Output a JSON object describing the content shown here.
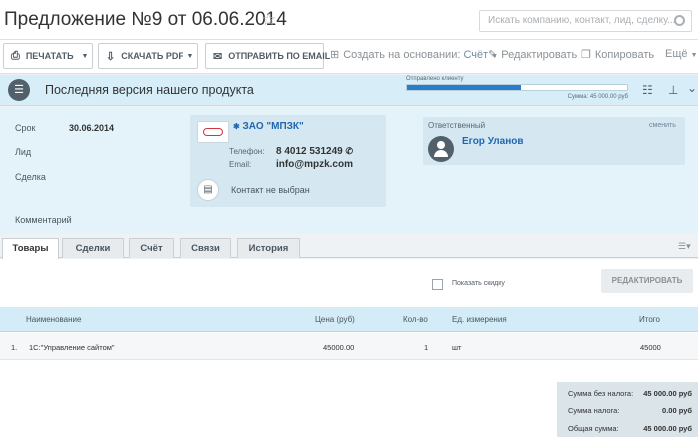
{
  "header": {
    "title": "Предложение №9 от 06.06.2014",
    "search_placeholder": "Искать компанию, контакт, лид, сделку..."
  },
  "toolbar": {
    "print_label": "ПЕЧАТАТЬ",
    "pdf_label": "СКАЧАТЬ PDF",
    "email_label": "ОТПРАВИТЬ ПО EMAIL",
    "create_label": "Создать на основании:",
    "create_value": "Счёт",
    "edit_label": "Редактировать",
    "copy_label": "Копировать",
    "more_label": "Ещё"
  },
  "banner": {
    "title": "Последняя версия нашего продукта",
    "progress_label": "Отправлено клиенту",
    "progress_fraction": 0.52,
    "sum_label": "Сумма: 45 000.00 руб"
  },
  "details": {
    "term_label": "Срок",
    "term_value": "30.06.2014",
    "lead_label": "Лид",
    "deal_label": "Сделка",
    "comment_label": "Комментарий"
  },
  "company": {
    "name": "ЗАО \"МПЗК\"",
    "phone_label": "Телефон:",
    "phone_value": "8 4012 531249",
    "email_label": "Email:",
    "email_value": "info@mpzk.com",
    "contact_label": "Контакт не выбран"
  },
  "responsible": {
    "label": "Ответственный",
    "change_label": "сменить",
    "name": "Егор Уланов"
  },
  "tabs": [
    {
      "label": "Товары"
    },
    {
      "label": "Сделки"
    },
    {
      "label": "Счёт"
    },
    {
      "label": "Связи"
    },
    {
      "label": "История"
    }
  ],
  "products": {
    "show_discount_label": "Показать скидку",
    "edit_label": "РЕДАКТИРОВАТЬ",
    "columns": [
      "Наименование",
      "Цена (руб)",
      "Кол-во",
      "Ед. измерения",
      "Итого"
    ],
    "rows": [
      {
        "num": "1.",
        "name": "1С:\"Управление сайтом\"",
        "price": "45000.00",
        "qty": "1",
        "unit": "шт",
        "total": "45000"
      }
    ]
  },
  "totals": {
    "subtotal_label": "Сумма без налога:",
    "subtotal_value": "45 000.00 руб",
    "tax_label": "Сумма налога:",
    "tax_value": "0.00 руб",
    "total_label": "Общая сумма:",
    "total_value": "45 000.00 руб"
  }
}
